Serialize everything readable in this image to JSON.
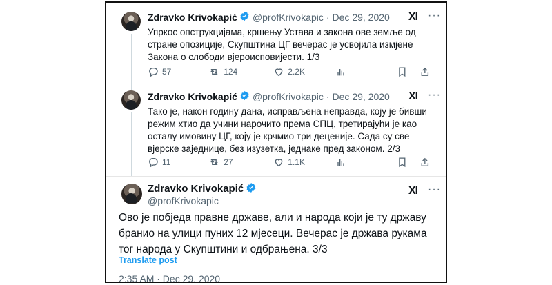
{
  "tweets": [
    {
      "name": "Zdravko Krivokapić",
      "handle": "@profKrivokapic",
      "separator": "·",
      "date": "Dec 29, 2020",
      "text": "Упркос опструкцијама, кршењу Устава и закона ове земље од стране опозиције, Скупштина ЦГ вечерас је усвојила измјене Закона о слободи вјероисповијести. 1/3",
      "replies": "57",
      "reposts": "124",
      "likes": "2.2K"
    },
    {
      "name": "Zdravko Krivokapić",
      "handle": "@profKrivokapic",
      "separator": "·",
      "date": "Dec 29, 2020",
      "text": "Тако је, након годину дана, исправљена неправда, коју је бивши режим хтио да учини нарочито према СПЦ, третирајући је као осталу имовину ЦГ, коју је крчмио три деценије. Сада су све вјерске заједнице, без изузетка, једнаке пред законом. 2/3",
      "replies": "11",
      "reposts": "27",
      "likes": "1.1K"
    }
  ],
  "main_tweet": {
    "name": "Zdravko Krivokapić",
    "handle": "@profKrivokapic",
    "text": "Ово је побједа правне државе, али и народа који је ту државу бранио на улици пуних 12 мјесеци. Вечерас је држава рукама тог народа у Скупштини и одбрањена. 3/3",
    "translate_label": "Translate post",
    "timestamp": "2:35 AM · Dec 29, 2020"
  },
  "icons": {
    "grok": "XI",
    "more": "···"
  },
  "colors": {
    "accent": "#1d9bf0",
    "muted": "#536471",
    "text": "#0f1419"
  }
}
